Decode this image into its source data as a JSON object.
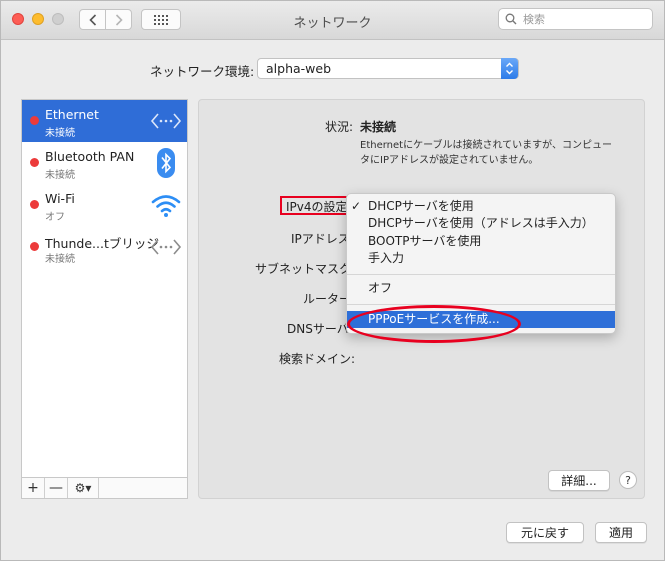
{
  "window": {
    "title": "ネットワーク"
  },
  "search": {
    "placeholder": "検索"
  },
  "location": {
    "label": "ネットワーク環境:",
    "value": "alpha-web"
  },
  "services": [
    {
      "name": "Ethernet",
      "status": "未接続",
      "icon": "ethernet-arrows-icon",
      "selected": true
    },
    {
      "name": "Bluetooth PAN",
      "status": "未接続",
      "icon": "bluetooth-icon"
    },
    {
      "name": "Wi-Fi",
      "status": "オフ",
      "icon": "wifi-icon"
    },
    {
      "name": "Thunde...tブリッジ",
      "status": "未接続",
      "icon": "thunderbolt-bridge-arrows-icon"
    }
  ],
  "sidebar_toolbar": {
    "add": "+",
    "remove": "—",
    "gear": "⚙︎▾"
  },
  "detail": {
    "status_label": "状況:",
    "status_value": "未接続",
    "status_desc": "Ethernetにケーブルは接続されていますが、コンピュータにIPアドレスが設定されていません。",
    "ipv4_label": "IPv4の設定",
    "ip_label": "IPアドレス",
    "subnet_label": "サブネットマスク",
    "router_label": "ルーター",
    "dns_label": "DNSサーバ",
    "search_domain_label": "検索ドメイン:"
  },
  "menu": {
    "check": "✓",
    "items": [
      "DHCPサーバを使用",
      "DHCPサーバを使用（アドレスは手入力）",
      "BOOTPサーバを使用",
      "手入力"
    ],
    "off": "オフ",
    "pppoe": "PPPoEサービスを作成..."
  },
  "buttons": {
    "details": "詳細...",
    "help": "?",
    "revert": "元に戻す",
    "apply": "適用"
  },
  "colors": {
    "selection": "#2f6dd7",
    "annotation": "#e8001f",
    "status_dot": "#ec3b3b"
  }
}
